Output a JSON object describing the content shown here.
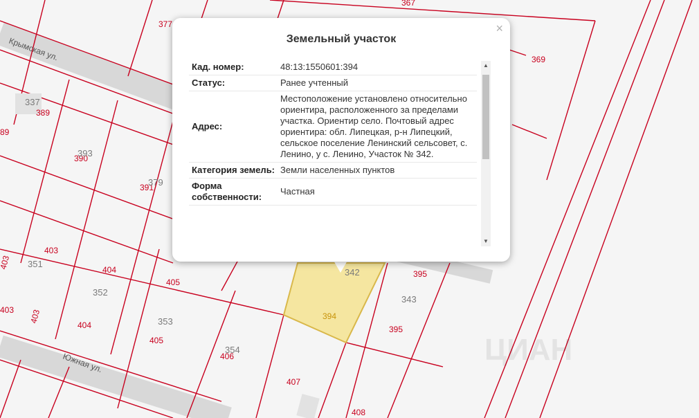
{
  "map": {
    "streets": [
      "Крымская ул.",
      "Южная ул."
    ],
    "parcel_numbers": [
      "377",
      "367",
      "369",
      "337",
      "389",
      "89",
      "390",
      "393",
      "391",
      "379",
      "403",
      "403",
      "351",
      "404",
      "352",
      "405",
      "403",
      "403",
      "404",
      "353",
      "405",
      "354",
      "406",
      "407",
      "408",
      "343",
      "395",
      "395",
      "394",
      "342"
    ],
    "highlighted_parcel": "394",
    "colors": {
      "parcel_line": "#c8001e",
      "highlight_fill": "#f5e6a0",
      "highlight_border": "#d9b84a"
    },
    "watermark": "ЦИАН"
  },
  "popup": {
    "title": "Земельный участок",
    "close_icon": "×",
    "rows": [
      {
        "label": "Кад. номер:",
        "value": "48:13:1550601:394"
      },
      {
        "label": "Статус:",
        "value": "Ранее учтенный"
      },
      {
        "label": "Адрес:",
        "value": "Местоположение установлено относительно ориентира, расположенного за пределами участка. Ориентир село. Почтовый адрес ориентира: обл. Липецкая, р-н Липецкий, сельское поселение Ленинский сельсовет, с. Ленино, у с. Ленино, Участок № 342."
      },
      {
        "label": "Категория земель:",
        "value": "Земли населенных пунктов"
      },
      {
        "label": "Форма собственности:",
        "value": "Частная"
      }
    ],
    "scroll_up": "▲",
    "scroll_down": "▼"
  }
}
